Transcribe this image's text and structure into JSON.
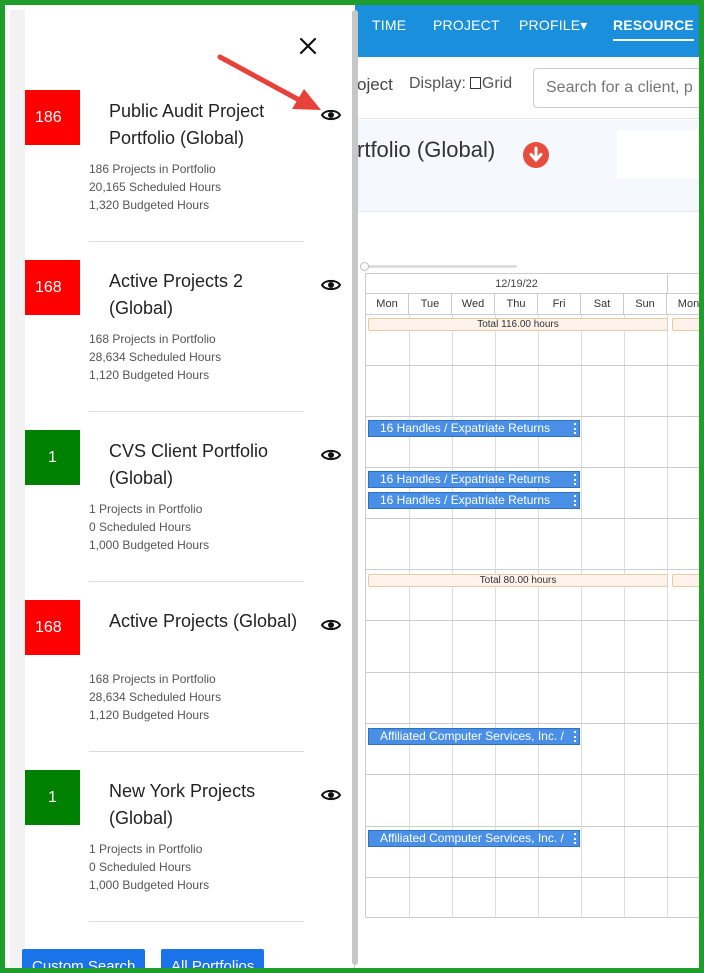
{
  "topnav": {
    "items": [
      {
        "label": "TIME"
      },
      {
        "label": "PROJECT"
      },
      {
        "label": "PROFILE▾"
      },
      {
        "label": "RESOURCE"
      }
    ]
  },
  "toolbar": {
    "project_fragment": "oject",
    "display_label": "Display:",
    "grid_label": "Grid",
    "search_placeholder": "Search for a client, p"
  },
  "page_title": "rtfolio (Global)",
  "calendar": {
    "week_label": "12/19/22",
    "days": [
      "Mon",
      "Tue",
      "Wed",
      "Thu",
      "Fri",
      "Sat",
      "Sun",
      "Mon"
    ],
    "totals": [
      "Total 116.00 hours",
      "Total 80.00 hours"
    ],
    "events": [
      "16 Handles / Expatriate Returns",
      "16 Handles / Expatriate Returns",
      "16 Handles / Expatriate Returns",
      "Affiliated Computer Services, Inc. /",
      "Affiliated Computer Services, Inc. /"
    ]
  },
  "panel": {
    "portfolios": [
      {
        "badge": "186",
        "color": "#ff0000",
        "title": "Public Audit Project Portfolio (Global)",
        "projects": "186 Projects in Portfolio",
        "scheduled": "20,165 Scheduled Hours",
        "budgeted": "1,320 Budgeted Hours"
      },
      {
        "badge": "168",
        "color": "#ff0000",
        "title": "Active Projects 2 (Global)",
        "projects": "168 Projects in Portfolio",
        "scheduled": "28,634 Scheduled Hours",
        "budgeted": "1,120 Budgeted Hours"
      },
      {
        "badge": "1",
        "color": "#008000",
        "title": "CVS Client Portfolio (Global)",
        "projects": "1 Projects in Portfolio",
        "scheduled": "0 Scheduled Hours",
        "budgeted": "1,000 Budgeted Hours"
      },
      {
        "badge": "168",
        "color": "#ff0000",
        "title": "Active Projects (Global)",
        "projects": "168 Projects in Portfolio",
        "scheduled": "28,634 Scheduled Hours",
        "budgeted": "1,120 Budgeted Hours"
      },
      {
        "badge": "1",
        "color": "#008000",
        "title": "New York Projects (Global)",
        "projects": "1 Projects in Portfolio",
        "scheduled": "0 Scheduled Hours",
        "budgeted": "1,000 Budgeted Hours"
      }
    ],
    "buttons": {
      "custom_search": "Custom Search",
      "all_portfolios": "All Portfolios"
    }
  },
  "colors": {
    "nav": "#1a8fdc",
    "border_highlight": "#1f9e2c",
    "arrow": "#e8413a",
    "event": "#4a8fe6"
  }
}
